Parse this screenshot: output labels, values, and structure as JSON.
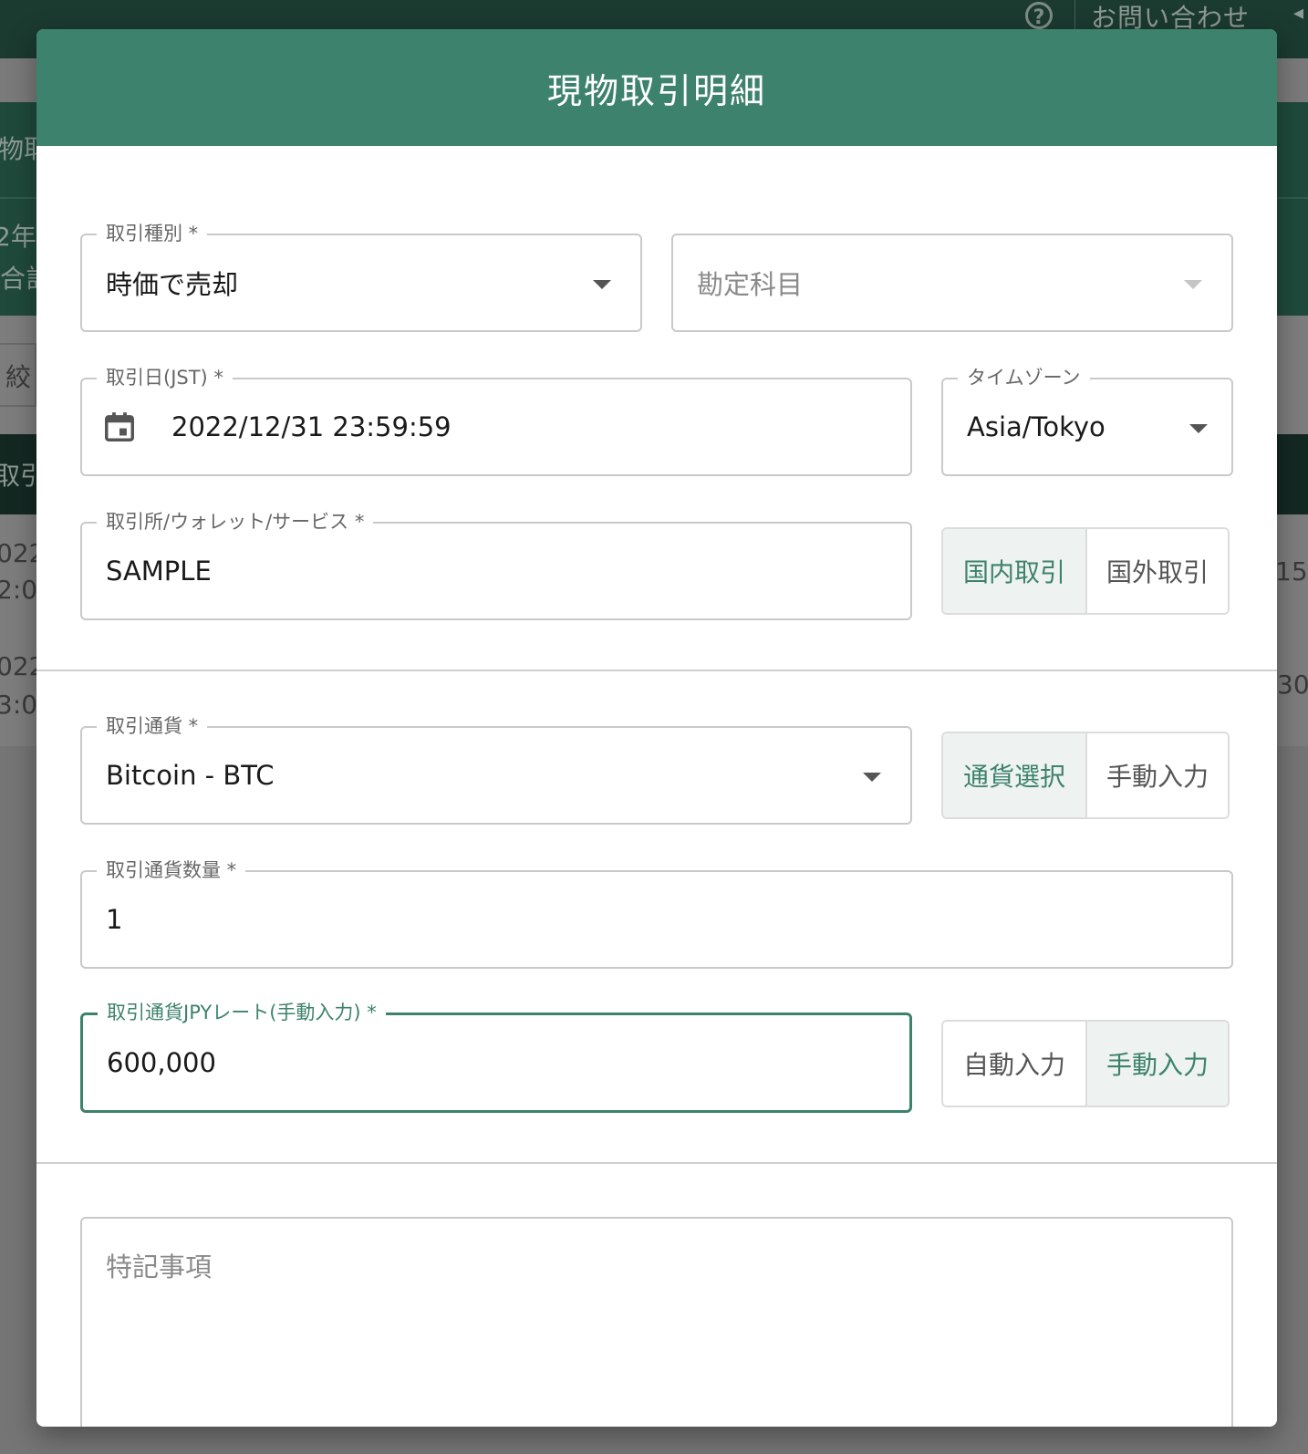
{
  "background": {
    "topbar": {
      "help_label": "?",
      "contact": "お問い合わせ",
      "collapse_glyph": "◂"
    },
    "fragments": [
      "物取",
      "2年",
      "合計",
      "絞",
      "取引",
      "022",
      "2:0",
      "022",
      "3:0",
      "15",
      "30"
    ]
  },
  "modal": {
    "title": "現物取引明細",
    "transaction_type": {
      "label": "取引種別 *",
      "value": "時価で売却"
    },
    "account_item": {
      "placeholder": "勘定科目"
    },
    "trade_date": {
      "label": "取引日(JST) *",
      "value": "2022/12/31 23:59:59"
    },
    "timezone": {
      "label": "タイムゾーン",
      "value": "Asia/Tokyo"
    },
    "exchange": {
      "label": "取引所/ウォレット/サービス *",
      "value": "SAMPLE"
    },
    "exchange_toggle": {
      "domestic": "国内取引",
      "overseas": "国外取引",
      "selected": "domestic"
    },
    "currency": {
      "label": "取引通貨 *",
      "value": "Bitcoin - BTC"
    },
    "currency_toggle": {
      "select": "通貨選択",
      "manual": "手動入力",
      "selected": "select"
    },
    "quantity": {
      "label": "取引通貨数量 *",
      "value": "1"
    },
    "jpy_rate": {
      "label": "取引通貨JPYレート(手動入力) *",
      "value": "600,000"
    },
    "rate_toggle": {
      "auto": "自動入力",
      "manual": "手動入力",
      "selected": "manual"
    },
    "notes": {
      "placeholder": "特記事項"
    }
  },
  "colors": {
    "primary": "#3d826c",
    "header_bg": "#3d826c",
    "topbar_bg": "#1b3a30"
  }
}
